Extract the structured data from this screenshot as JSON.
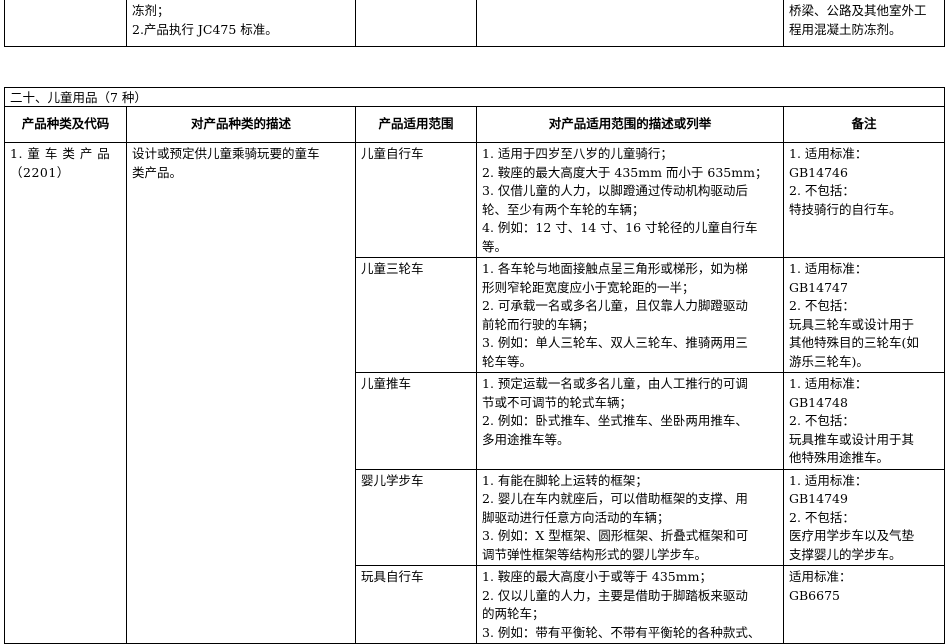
{
  "top_fragment": {
    "col1_lines": [],
    "col2_lines": [
      "冻剂；",
      "2.产品执行 JC475 标准。"
    ],
    "col3_lines": [],
    "col4_lines": [],
    "col5_lines": [
      "桥梁、公路及其他室外工",
      "程用混凝土防冻剂。"
    ]
  },
  "section": {
    "title": "二十、儿童用品（7 种）",
    "headers": {
      "category": "产品种类及代码",
      "category_desc": "对产品种类的描述",
      "scope": "产品适用范围",
      "scope_desc": "对产品适用范围的描述或列举",
      "remarks": "备注"
    },
    "category": {
      "lines": [
        "1. 童 车 类 产 品",
        "（2201）"
      ],
      "desc_lines": [
        "设计或预定供儿童乘骑玩要的童车",
        "类产品。"
      ]
    },
    "rows": [
      {
        "scope": "儿童自行车",
        "desc_lines": [
          "1. 适用于四岁至八岁的儿童骑行；",
          "2. 鞍座的最大高度大于 435mm 而小于 635mm；",
          "3. 仅借儿童的人力，以脚蹬通过传动机构驱动后",
          "轮、至少有两个车轮的车辆；",
          "4. 例如：12 寸、14 寸、16 寸轮径的儿童自行车",
          "等。"
        ],
        "remark_lines": [
          "1. 适用标准：",
          "GB14746",
          "2. 不包括：",
          "特技骑行的自行车。"
        ]
      },
      {
        "scope": "儿童三轮车",
        "desc_lines": [
          "1. 各车轮与地面接触点呈三角形或梯形，如为梯",
          "形则窄轮距宽度应小于宽轮距的一半；",
          "2. 可承载一名或多名儿童，且仅靠人力脚蹬驱动",
          "前轮而行驶的车辆；",
          "3. 例如：单人三轮车、双人三轮车、推骑两用三",
          "轮车等。"
        ],
        "remark_lines": [
          "1. 适用标准：",
          "GB14747",
          "2. 不包括：",
          "玩具三轮车或设计用于",
          "其他特殊目的三轮车(如",
          "游乐三轮车)。"
        ]
      },
      {
        "scope": "儿童推车",
        "desc_lines": [
          "1. 预定运载一名或多名儿童，由人工推行的可调",
          "节或不可调节的轮式车辆；",
          "2. 例如：卧式推车、坐式推车、坐卧两用推车、",
          "多用途推车等。"
        ],
        "remark_lines": [
          "1. 适用标准：",
          "GB14748",
          "2. 不包括：",
          "玩具推车或设计用于其",
          "他特殊用途推车。"
        ]
      },
      {
        "scope": "婴儿学步车",
        "desc_lines": [
          "1. 有能在脚轮上运转的框架；",
          "2. 婴儿在车内就座后，可以借助框架的支撑、用",
          "脚驱动进行任意方向活动的车辆；",
          "3. 例如：X 型框架、圆形框架、折叠式框架和可",
          "调节弹性框架等结构形式的婴儿学步车。"
        ],
        "remark_lines": [
          "1. 适用标准：",
          "GB14749",
          "2. 不包括：",
          "医疗用学步车以及气垫",
          "支撑婴儿的学步车。"
        ]
      },
      {
        "scope": "玩具自行车",
        "desc_lines": [
          "1. 鞍座的最大高度小于或等于 435mm；",
          "2. 仅以儿童的人力，主要是借助于脚踏板来驱动",
          "的两轮车；",
          "3. 例如：带有平衡轮、不带有平衡轮的各种款式、"
        ],
        "remark_lines": [
          "适用标准：",
          "GB6675"
        ]
      }
    ]
  }
}
